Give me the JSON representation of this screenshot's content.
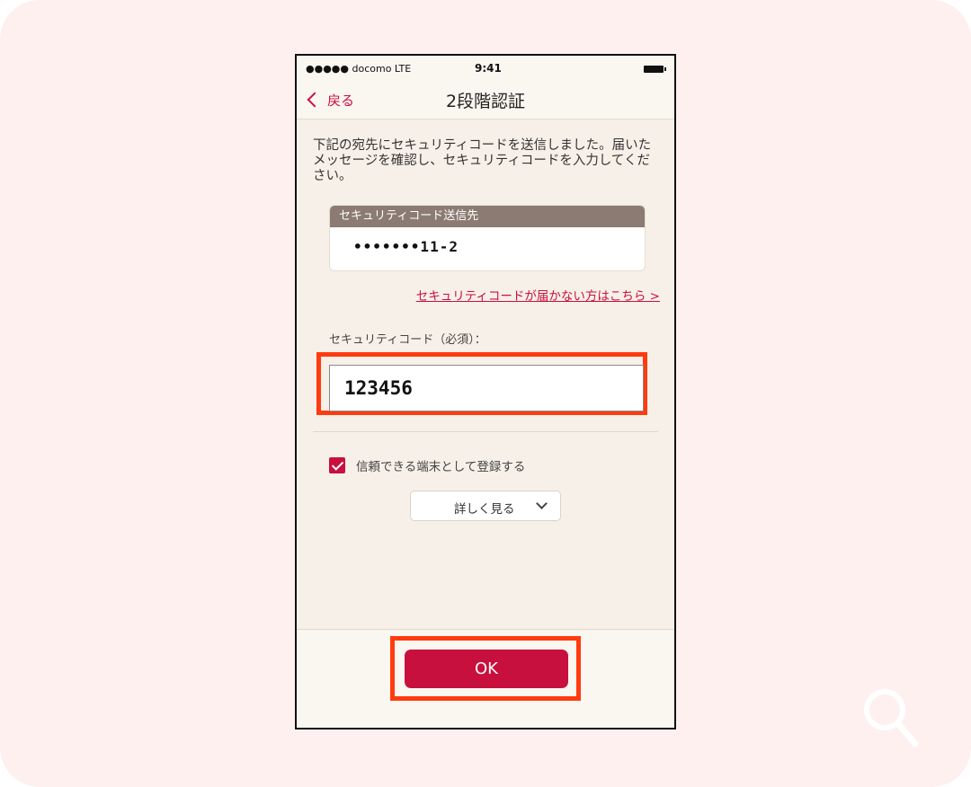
{
  "status_bar": {
    "carrier": "●●●●● docomo  LTE",
    "time": "9:41"
  },
  "nav": {
    "back_label": "戻る",
    "title": "2段階認証"
  },
  "description": "下記の宛先にセキュリティコードを送信しました。届いたメッセージを確認し、セキュリティコードを入力してください。",
  "destination": {
    "header": "セキュリティコード送信先",
    "value": "•••••••11-2"
  },
  "resend_link": "セキュリティコードが届かない方はこちら >",
  "code_field": {
    "label": "セキュリティコード（必須）：",
    "value": "123456"
  },
  "trust_device": {
    "label": "信頼できる端末として登録する",
    "checked": true
  },
  "details_button": "詳しく見る",
  "ok_button": "OK",
  "colors": {
    "accent": "#c8103e",
    "highlight": "#ff3b0f",
    "background": "#fdf0ef"
  }
}
